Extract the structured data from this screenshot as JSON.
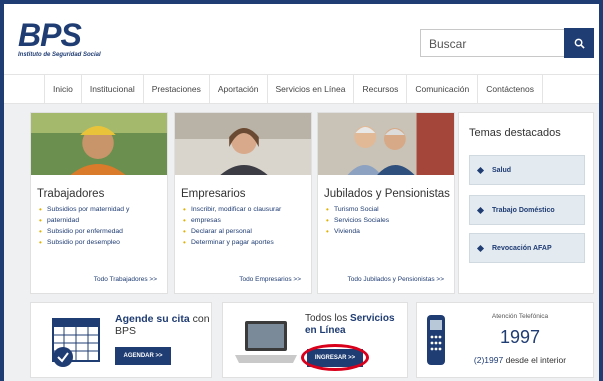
{
  "logo": {
    "text": "BPS",
    "subtitle": "Instituto de Seguridad Social"
  },
  "search": {
    "placeholder": "Buscar"
  },
  "nav": [
    "Inicio",
    "Institucional",
    "Prestaciones",
    "Aportación",
    "Servicios en Línea",
    "Recursos",
    "Comunicación",
    "Contáctenos"
  ],
  "cards": {
    "trabajadores": {
      "title": "Trabajadores",
      "items": [
        "Subsidios por maternidad y",
        "paternidad",
        "Subsidio por enfermedad",
        "Subsidio por desempleo"
      ],
      "more": "Todo Trabajadores >>"
    },
    "empresarios": {
      "title": "Empresarios",
      "items": [
        "Inscribir, modificar o clausurar",
        "empresas",
        "Declarar al personal",
        "Determinar y pagar aportes"
      ],
      "more": "Todo Empresarios >>"
    },
    "jubilados": {
      "title": "Jubilados y Pensionistas",
      "items": [
        "Turismo Social",
        "Servicios Sociales",
        "Vivienda"
      ],
      "more": "Todo Jubilados y Pensionistas >>"
    }
  },
  "temas": {
    "title": "Temas destacados",
    "items": [
      "Salud",
      "Trabajo Doméstico",
      "Revocación AFAP"
    ]
  },
  "agenda": {
    "line1": "Agende su cita",
    "con": "con",
    "line2": "BPS",
    "button": "AGENDAR >>"
  },
  "servicios": {
    "line1a": "Todos los",
    "line1b": "Servicios",
    "line2": "en Línea",
    "button": "INGRESAR >>"
  },
  "telefono": {
    "label": "Atención Telefónica",
    "number": "1997",
    "interior_prefix": "(2)1997",
    "interior_suffix": "desde el interior"
  },
  "colors": {
    "brand": "#1f3c73",
    "highlight": "#d9001b",
    "bullet": "#e0b100"
  }
}
